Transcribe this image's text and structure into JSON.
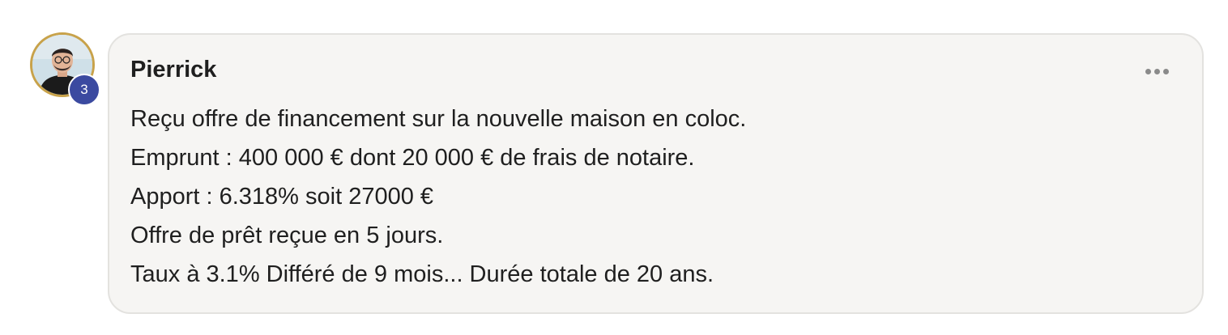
{
  "post": {
    "author": "Pierrick",
    "avatar": {
      "badge_count": "3",
      "ring_color": "#c8a24a",
      "badge_color": "#3b4aa0"
    },
    "more_icon": "more-horizontal-icon",
    "lines": [
      "Reçu offre de financement sur la nouvelle maison en coloc.",
      "Emprunt : 400 000 € dont 20 000 € de frais de notaire.",
      "Apport : 6.318% soit 27000 €",
      "Offre de prêt reçue en 5 jours.",
      "Taux à 3.1% Différé de 9 mois... Durée totale de 20 ans."
    ]
  }
}
